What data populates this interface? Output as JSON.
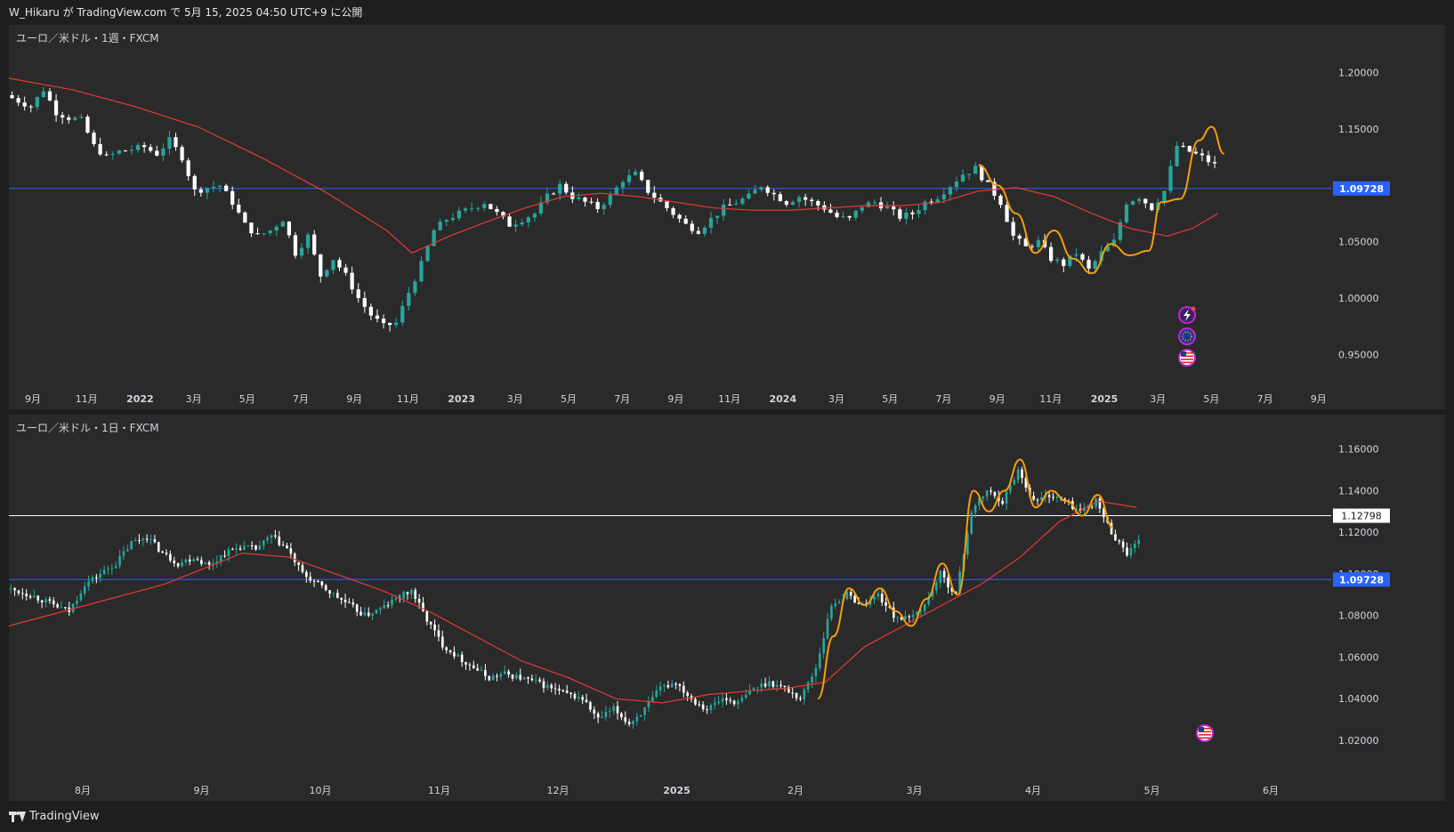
{
  "header": {
    "published_text": "W_Hikaru が TradingView.com で 5月 15, 2025 04:50 UTC+9 に公開"
  },
  "footer": {
    "brand": "TradingView"
  },
  "colors": {
    "bull": "#26a69a",
    "bear": "#ffffff",
    "ma_line": "#e53935",
    "swing_line": "#f59e0b",
    "hline_blue": "#2962ff",
    "hline_white": "#ffffff",
    "pane_bg": "#2a2a2a"
  },
  "icons": [
    "lightning-icon",
    "globe-flag-icon",
    "us-flag-icon"
  ],
  "chart_data": [
    {
      "type": "candlestick",
      "title": "ユーロ／米ドル・1週・FXCM",
      "symbol": "EURUSD",
      "interval": "1週",
      "source": "FXCM",
      "x_labels": [
        "9月",
        "11月",
        "2022",
        "3月",
        "5月",
        "7月",
        "9月",
        "11月",
        "2023",
        "3月",
        "5月",
        "7月",
        "9月",
        "11月",
        "2024",
        "3月",
        "5月",
        "7月",
        "9月",
        "11月",
        "2025",
        "3月",
        "5月",
        "7月",
        "9月"
      ],
      "y_ticks": [
        "1.20000",
        "1.15000",
        "1.10000",
        "1.05000",
        "1.00000",
        "0.95000"
      ],
      "ylim": [
        0.925,
        1.225
      ],
      "price_line": {
        "label": "1.09728",
        "value": 1.09728,
        "color": "#2962ff"
      },
      "close_path": [
        [
          0,
          1.18
        ],
        [
          2,
          1.175
        ],
        [
          4,
          1.17
        ],
        [
          6,
          1.185
        ],
        [
          8,
          1.165
        ],
        [
          10,
          1.16
        ],
        [
          12,
          1.158
        ],
        [
          14,
          1.135
        ],
        [
          16,
          1.125
        ],
        [
          18,
          1.13
        ],
        [
          20,
          1.132
        ],
        [
          22,
          1.134
        ],
        [
          24,
          1.128
        ],
        [
          26,
          1.14
        ],
        [
          28,
          1.125
        ],
        [
          30,
          1.095
        ],
        [
          32,
          1.098
        ],
        [
          34,
          1.1
        ],
        [
          36,
          1.085
        ],
        [
          38,
          1.065
        ],
        [
          40,
          1.055
        ],
        [
          42,
          1.06
        ],
        [
          44,
          1.07
        ],
        [
          46,
          1.04
        ],
        [
          48,
          1.055
        ],
        [
          50,
          1.02
        ],
        [
          52,
          1.035
        ],
        [
          54,
          1.02
        ],
        [
          56,
          1.0
        ],
        [
          58,
          0.985
        ],
        [
          60,
          0.975
        ],
        [
          62,
          0.978
        ],
        [
          64,
          1.005
        ],
        [
          66,
          1.03
        ],
        [
          68,
          1.06
        ],
        [
          70,
          1.07
        ],
        [
          72,
          1.075
        ],
        [
          74,
          1.08
        ],
        [
          76,
          1.085
        ],
        [
          78,
          1.075
        ],
        [
          80,
          1.065
        ],
        [
          82,
          1.07
        ],
        [
          84,
          1.075
        ],
        [
          86,
          1.09
        ],
        [
          88,
          1.1
        ],
        [
          90,
          1.09
        ],
        [
          92,
          1.085
        ],
        [
          94,
          1.08
        ],
        [
          96,
          1.09
        ],
        [
          98,
          1.105
        ],
        [
          100,
          1.11
        ],
        [
          102,
          1.095
        ],
        [
          104,
          1.085
        ],
        [
          106,
          1.075
        ],
        [
          108,
          1.065
        ],
        [
          110,
          1.06
        ],
        [
          112,
          1.07
        ],
        [
          114,
          1.08
        ],
        [
          116,
          1.085
        ],
        [
          118,
          1.09
        ],
        [
          120,
          1.1
        ],
        [
          122,
          1.092
        ],
        [
          124,
          1.085
        ],
        [
          126,
          1.09
        ],
        [
          128,
          1.085
        ],
        [
          130,
          1.08
        ],
        [
          132,
          1.072
        ],
        [
          134,
          1.07
        ],
        [
          136,
          1.082
        ],
        [
          138,
          1.085
        ],
        [
          140,
          1.08
        ],
        [
          142,
          1.072
        ],
        [
          144,
          1.075
        ],
        [
          146,
          1.085
        ],
        [
          148,
          1.09
        ],
        [
          150,
          1.1
        ],
        [
          152,
          1.11
        ],
        [
          154,
          1.115
        ],
        [
          156,
          1.1
        ],
        [
          158,
          1.085
        ],
        [
          160,
          1.055
        ],
        [
          162,
          1.045
        ],
        [
          164,
          1.05
        ],
        [
          166,
          1.035
        ],
        [
          168,
          1.03
        ],
        [
          170,
          1.04
        ],
        [
          172,
          1.025
        ],
        [
          174,
          1.04
        ],
        [
          176,
          1.05
        ],
        [
          178,
          1.085
        ],
        [
          180,
          1.09
        ],
        [
          182,
          1.08
        ],
        [
          184,
          1.095
        ],
        [
          186,
          1.135
        ],
        [
          188,
          1.13
        ],
        [
          190,
          1.125
        ],
        [
          192,
          1.118
        ]
      ],
      "ma_path": [
        [
          0,
          1.195
        ],
        [
          10,
          1.185
        ],
        [
          20,
          1.17
        ],
        [
          30,
          1.152
        ],
        [
          40,
          1.125
        ],
        [
          50,
          1.095
        ],
        [
          60,
          1.06
        ],
        [
          64,
          1.04
        ],
        [
          70,
          1.055
        ],
        [
          76,
          1.068
        ],
        [
          82,
          1.08
        ],
        [
          88,
          1.09
        ],
        [
          94,
          1.093
        ],
        [
          100,
          1.09
        ],
        [
          106,
          1.085
        ],
        [
          112,
          1.08
        ],
        [
          118,
          1.078
        ],
        [
          124,
          1.078
        ],
        [
          130,
          1.08
        ],
        [
          136,
          1.082
        ],
        [
          142,
          1.082
        ],
        [
          148,
          1.085
        ],
        [
          154,
          1.095
        ],
        [
          160,
          1.098
        ],
        [
          166,
          1.09
        ],
        [
          172,
          1.075
        ],
        [
          178,
          1.062
        ],
        [
          184,
          1.055
        ],
        [
          188,
          1.062
        ],
        [
          192,
          1.075
        ]
      ],
      "swing_path": [
        [
          154,
          1.118
        ],
        [
          157,
          1.1
        ],
        [
          160,
          1.075
        ],
        [
          163,
          1.04
        ],
        [
          166,
          1.06
        ],
        [
          169,
          1.035
        ],
        [
          172,
          1.022
        ],
        [
          175,
          1.048
        ],
        [
          178,
          1.038
        ],
        [
          181,
          1.042
        ],
        [
          183,
          1.085
        ],
        [
          186,
          1.088
        ],
        [
          189,
          1.14
        ],
        [
          191,
          1.152
        ],
        [
          193,
          1.128
        ]
      ],
      "n_candles": 192,
      "x_range_end": 210
    },
    {
      "type": "candlestick",
      "title": "ユーロ／米ドル・1日・FXCM",
      "symbol": "EURUSD",
      "interval": "1日",
      "source": "FXCM",
      "x_labels": [
        "8月",
        "9月",
        "10月",
        "11月",
        "12月",
        "2025",
        "2月",
        "3月",
        "4月",
        "5月",
        "6月"
      ],
      "y_ticks": [
        "1.16000",
        "1.14000",
        "1.12000",
        "1.10000",
        "1.08000",
        "1.06000",
        "1.04000",
        "1.02000"
      ],
      "ylim": [
        1.008,
        1.168
      ],
      "price_line": {
        "label": "1.09728",
        "value": 1.09728,
        "color": "#2962ff"
      },
      "current_price": {
        "label": "1.12798",
        "value": 1.12798,
        "color": "#ffffff"
      },
      "close_path": [
        [
          0,
          1.093
        ],
        [
          6,
          1.09
        ],
        [
          12,
          1.085
        ],
        [
          16,
          1.082
        ],
        [
          20,
          1.095
        ],
        [
          24,
          1.1
        ],
        [
          28,
          1.105
        ],
        [
          32,
          1.115
        ],
        [
          36,
          1.118
        ],
        [
          40,
          1.11
        ],
        [
          44,
          1.105
        ],
        [
          48,
          1.108
        ],
        [
          52,
          1.104
        ],
        [
          56,
          1.11
        ],
        [
          60,
          1.113
        ],
        [
          64,
          1.112
        ],
        [
          68,
          1.118
        ],
        [
          72,
          1.112
        ],
        [
          76,
          1.1
        ],
        [
          80,
          1.095
        ],
        [
          84,
          1.09
        ],
        [
          88,
          1.085
        ],
        [
          92,
          1.08
        ],
        [
          96,
          1.083
        ],
        [
          100,
          1.088
        ],
        [
          104,
          1.092
        ],
        [
          108,
          1.078
        ],
        [
          112,
          1.066
        ],
        [
          116,
          1.06
        ],
        [
          120,
          1.055
        ],
        [
          124,
          1.05
        ],
        [
          128,
          1.052
        ],
        [
          132,
          1.05
        ],
        [
          136,
          1.048
        ],
        [
          140,
          1.045
        ],
        [
          144,
          1.042
        ],
        [
          148,
          1.04
        ],
        [
          152,
          1.03
        ],
        [
          156,
          1.035
        ],
        [
          160,
          1.028
        ],
        [
          164,
          1.035
        ],
        [
          168,
          1.045
        ],
        [
          172,
          1.048
        ],
        [
          176,
          1.04
        ],
        [
          180,
          1.035
        ],
        [
          184,
          1.04
        ],
        [
          188,
          1.038
        ],
        [
          192,
          1.045
        ],
        [
          196,
          1.048
        ],
        [
          200,
          1.045
        ],
        [
          204,
          1.04
        ],
        [
          208,
          1.055
        ],
        [
          212,
          1.085
        ],
        [
          216,
          1.09
        ],
        [
          220,
          1.085
        ],
        [
          224,
          1.09
        ],
        [
          228,
          1.08
        ],
        [
          232,
          1.078
        ],
        [
          236,
          1.085
        ],
        [
          240,
          1.1
        ],
        [
          244,
          1.09
        ],
        [
          248,
          1.13
        ],
        [
          252,
          1.14
        ],
        [
          256,
          1.135
        ],
        [
          260,
          1.15
        ],
        [
          264,
          1.135
        ],
        [
          268,
          1.138
        ],
        [
          272,
          1.135
        ],
        [
          276,
          1.13
        ],
        [
          280,
          1.135
        ],
        [
          284,
          1.12
        ],
        [
          288,
          1.11
        ],
        [
          291,
          1.115
        ]
      ],
      "ma_path": [
        [
          0,
          1.075
        ],
        [
          20,
          1.085
        ],
        [
          40,
          1.095
        ],
        [
          60,
          1.11
        ],
        [
          72,
          1.108
        ],
        [
          84,
          1.1
        ],
        [
          96,
          1.092
        ],
        [
          108,
          1.082
        ],
        [
          120,
          1.07
        ],
        [
          132,
          1.058
        ],
        [
          144,
          1.05
        ],
        [
          156,
          1.04
        ],
        [
          168,
          1.038
        ],
        [
          180,
          1.042
        ],
        [
          192,
          1.044
        ],
        [
          200,
          1.045
        ],
        [
          210,
          1.048
        ],
        [
          220,
          1.065
        ],
        [
          230,
          1.075
        ],
        [
          240,
          1.085
        ],
        [
          250,
          1.095
        ],
        [
          260,
          1.108
        ],
        [
          270,
          1.125
        ],
        [
          280,
          1.135
        ],
        [
          290,
          1.132
        ]
      ],
      "swing_path": [
        [
          208,
          1.04
        ],
        [
          212,
          1.07
        ],
        [
          216,
          1.093
        ],
        [
          220,
          1.085
        ],
        [
          224,
          1.093
        ],
        [
          228,
          1.082
        ],
        [
          232,
          1.075
        ],
        [
          236,
          1.088
        ],
        [
          240,
          1.105
        ],
        [
          244,
          1.09
        ],
        [
          248,
          1.14
        ],
        [
          252,
          1.13
        ],
        [
          256,
          1.14
        ],
        [
          260,
          1.155
        ],
        [
          264,
          1.132
        ],
        [
          268,
          1.14
        ],
        [
          272,
          1.135
        ],
        [
          276,
          1.128
        ],
        [
          280,
          1.138
        ],
        [
          284,
          1.122
        ]
      ],
      "n_candles": 291,
      "x_range_end": 340
    }
  ]
}
